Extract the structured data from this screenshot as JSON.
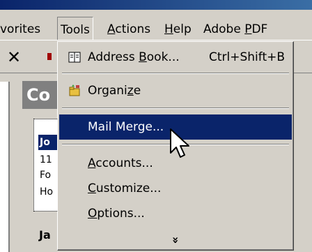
{
  "menubar": {
    "favorites": "vorites",
    "tools": "Tools",
    "actions_u": "A",
    "actions_rest": "ctions",
    "help_u": "H",
    "help_rest": "elp",
    "adobe_a": "Adobe ",
    "adobe_u": "P",
    "adobe_rest": "DF"
  },
  "tools_menu": {
    "address_book": {
      "pre": "Address ",
      "u": "B",
      "post": "ook...",
      "shortcut": "Ctrl+Shift+B"
    },
    "organize": {
      "pre": "Organi",
      "u": "z",
      "post": "e"
    },
    "mail_merge": {
      "label": "Mail Merge..."
    },
    "accounts": {
      "u": "A",
      "post": "ccounts..."
    },
    "customize": {
      "u": "C",
      "post": "ustomize..."
    },
    "options": {
      "u": "O",
      "post": "ptions..."
    },
    "expand": "»"
  },
  "contacts": {
    "header": "Co",
    "card_name": "Jo",
    "card_lines": [
      "11",
      "Fo",
      "Ho"
    ],
    "next_card": "Ja"
  },
  "colors": {
    "highlight": "#0a246a",
    "face": "#d4d0c8"
  }
}
